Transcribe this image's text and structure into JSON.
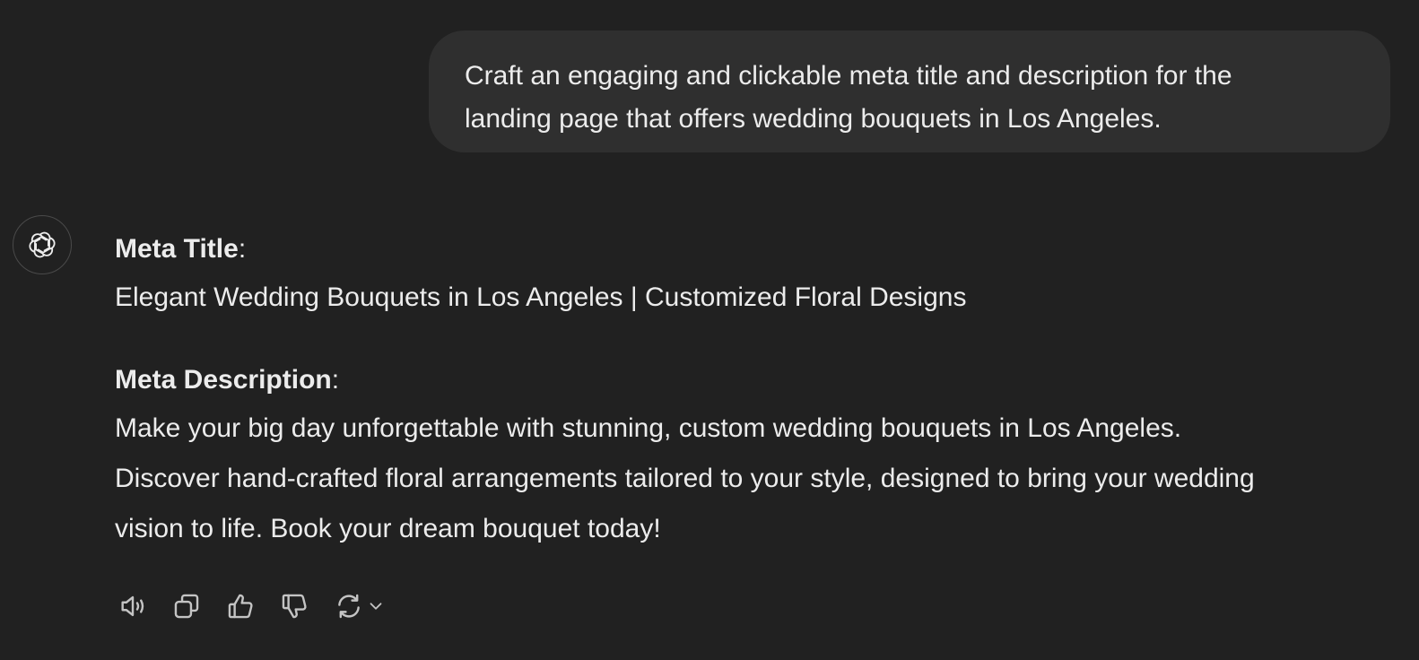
{
  "user_message": {
    "lines": [
      "Craft an engaging and clickable meta title and description for the",
      "landing page that offers wedding bouquets in Los Angeles."
    ]
  },
  "assistant": {
    "avatar_icon": "openai-logo-icon",
    "title_label": "Meta Title",
    "title_colon": ":",
    "title_text": "Elegant Wedding Bouquets in Los Angeles | Customized Floral Designs",
    "description_label": "Meta Description",
    "description_colon": ":",
    "description_lines": [
      "Make your big day unforgettable with stunning, custom wedding bouquets in Los Angeles.",
      "Discover hand-crafted floral arrangements tailored to your style, designed to bring your wedding",
      "vision to life. Book your dream bouquet today!"
    ]
  },
  "actions": {
    "icons": [
      "read-aloud-icon",
      "copy-icon",
      "thumbs-up-icon",
      "thumbs-down-icon",
      "regenerate-icon",
      "chevron-down-icon"
    ],
    "icon_color": "#c4c4c4"
  },
  "colors": {
    "background": "#212121",
    "user_bubble": "#2f2f2f",
    "text": "#ececec"
  }
}
